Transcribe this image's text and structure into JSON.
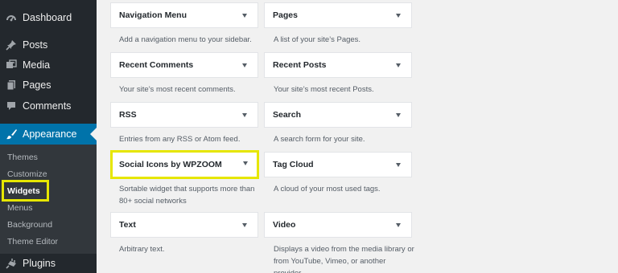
{
  "sidebar": {
    "menu": [
      {
        "id": "dashboard",
        "label": "Dashboard",
        "icon": "dashboard-icon"
      },
      {
        "id": "posts",
        "label": "Posts",
        "icon": "pushpin-icon"
      },
      {
        "id": "media",
        "label": "Media",
        "icon": "media-icon"
      },
      {
        "id": "pages",
        "label": "Pages",
        "icon": "page-icon"
      },
      {
        "id": "comments",
        "label": "Comments",
        "icon": "comment-icon"
      },
      {
        "id": "appearance",
        "label": "Appearance",
        "icon": "paintbrush-icon",
        "active": true
      },
      {
        "id": "plugins",
        "label": "Plugins",
        "icon": "plug-icon"
      }
    ],
    "submenu": [
      {
        "label": "Themes"
      },
      {
        "label": "Customize"
      },
      {
        "label": "Widgets",
        "current": true
      },
      {
        "label": "Menus"
      },
      {
        "label": "Background"
      },
      {
        "label": "Theme Editor"
      }
    ]
  },
  "widgets": [
    {
      "title": "Navigation Menu",
      "description": "Add a navigation menu to your sidebar."
    },
    {
      "title": "Pages",
      "description": "A list of your site’s Pages."
    },
    {
      "title": "Recent Comments",
      "description": "Your site’s most recent comments."
    },
    {
      "title": "Recent Posts",
      "description": "Your site’s most recent Posts."
    },
    {
      "title": "RSS",
      "description": "Entries from any RSS or Atom feed."
    },
    {
      "title": "Search",
      "description": "A search form for your site."
    },
    {
      "title": "Social Icons by WPZOOM",
      "description": "Sortable widget that supports more than 80+ social networks",
      "highlighted": true
    },
    {
      "title": "Tag Cloud",
      "description": "A cloud of your most used tags."
    },
    {
      "title": "Text",
      "description": "Arbitrary text."
    },
    {
      "title": "Video",
      "description": "Displays a video from the media library or from YouTube, Vimeo, or another provider."
    }
  ],
  "colors": {
    "sidebar_bg": "#23282d",
    "submenu_bg": "#32373c",
    "active_bg": "#0073aa",
    "highlight": "#e6e600"
  }
}
